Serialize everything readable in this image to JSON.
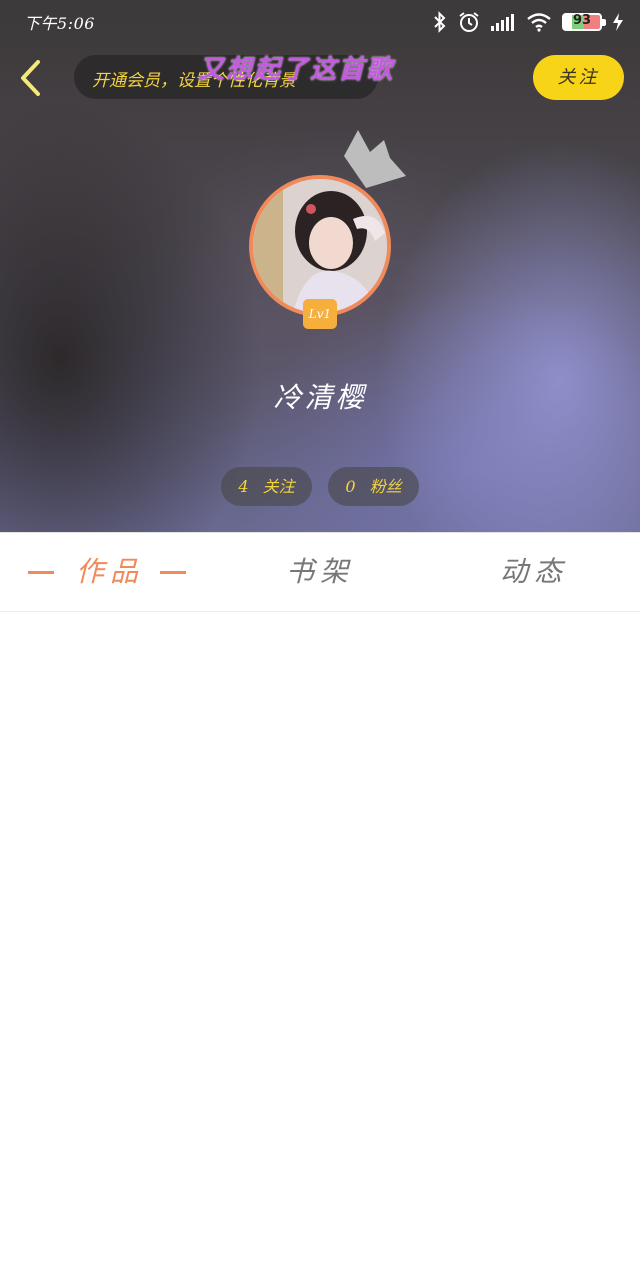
{
  "status_bar": {
    "time": "下午5:06",
    "battery": "93",
    "icons": [
      "bluetooth-icon",
      "alarm-icon",
      "signal-icon",
      "wifi-icon",
      "battery-icon",
      "charging-icon"
    ]
  },
  "header": {
    "back_icon": "chevron-left-icon",
    "vip_banner": "开通会员，设置个性化背景",
    "lyric_overlay": "又想起了这首歌",
    "follow_button": "关注"
  },
  "profile": {
    "level_badge": "Lv1",
    "username": "冷清樱",
    "following_count": "4",
    "following_label": "关注",
    "fans_count": "0",
    "fans_label": "粉丝"
  },
  "tabs": [
    {
      "label": "作品",
      "active": true
    },
    {
      "label": "书架",
      "active": false
    },
    {
      "label": "动态",
      "active": false
    }
  ],
  "colors": {
    "accent": "#f08a5a",
    "follow_yellow": "#f7d417",
    "pill_text": "#f5d340",
    "lyric_purple": "#c45ae0",
    "inactive_tab": "#777777"
  }
}
